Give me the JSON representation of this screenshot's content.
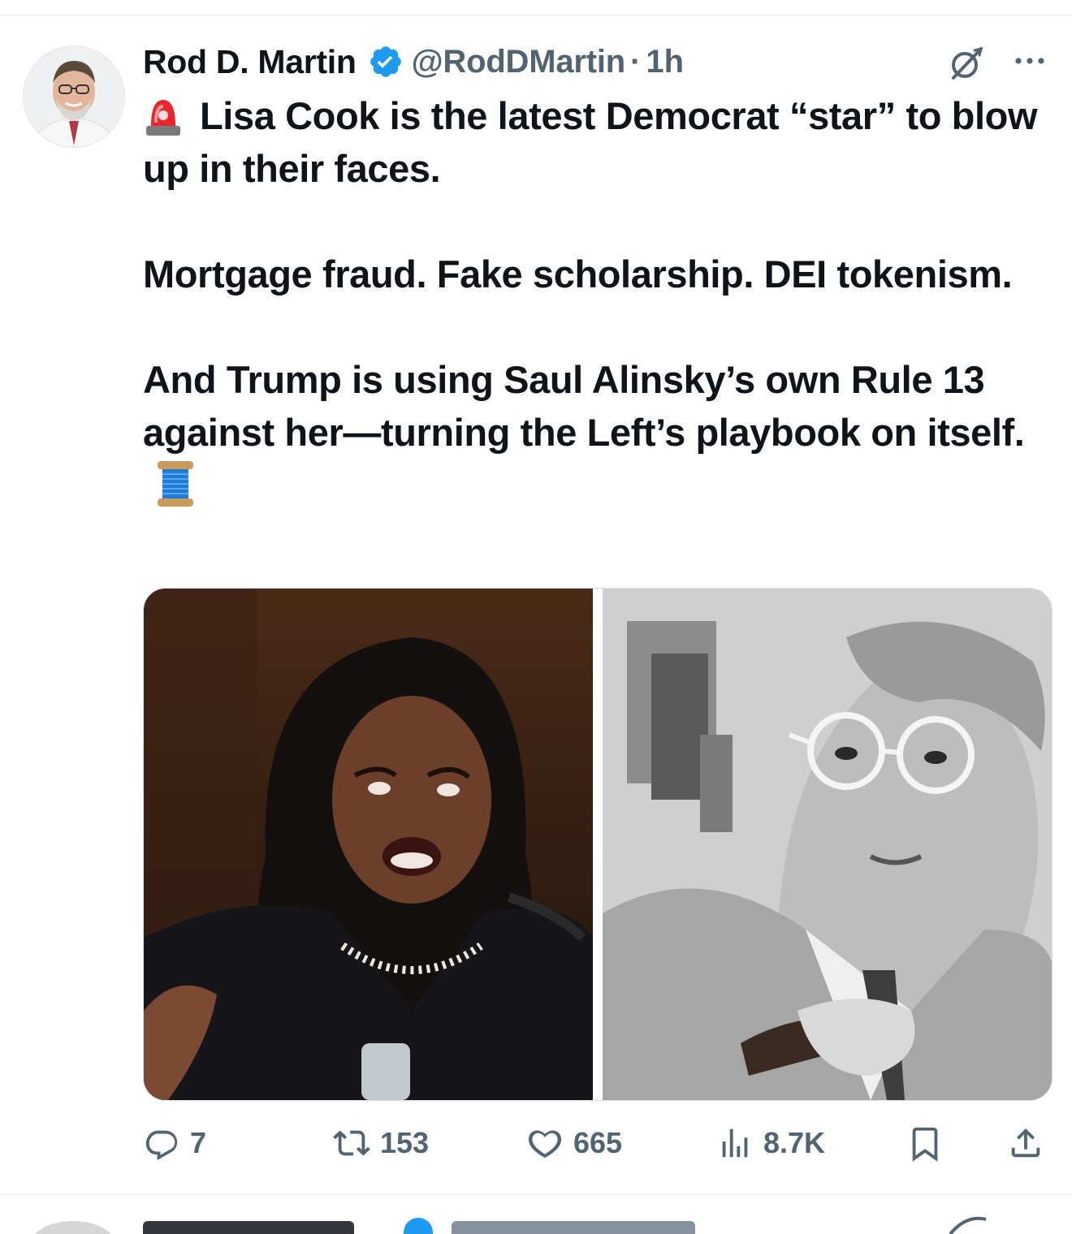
{
  "post": {
    "author_name": "Rod D. Martin",
    "handle": "@RodDMartin",
    "separator": "·",
    "time": "1h",
    "text": {
      "line1": "Lisa Cook is the latest Democrat “star” to blow up in their faces.",
      "line2": "Mortgage fraud. Fake scholarship. DEI tokenism.",
      "line3": "And Trump is using Saul Alinsky’s own Rule 13 against her—turning the Left’s playbook on itself."
    },
    "icons": {
      "lead_emoji": "police-light-emoji",
      "trail_emoji": "thread-spool-emoji",
      "verified": "verified-badge-icon",
      "grok": "grok-icon",
      "more": "more-icon"
    },
    "media": {
      "count": 2
    },
    "actions": {
      "replies": "7",
      "reposts": "153",
      "likes": "665",
      "views": "8.7K"
    },
    "colors": {
      "verified_blue": "#1d9bf0",
      "muted": "#536471",
      "text": "#0f1419",
      "divider": "#eff3f4"
    }
  }
}
